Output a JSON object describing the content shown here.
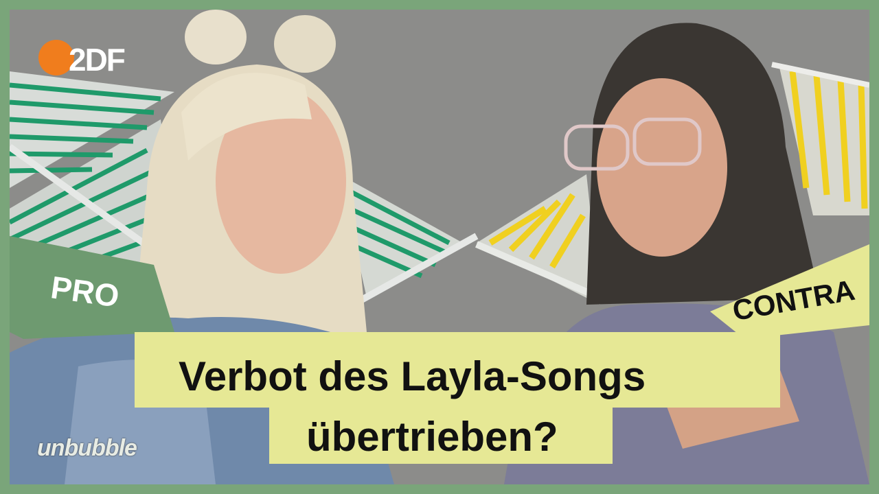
{
  "channel_logo": "2DF",
  "labels": {
    "pro": "PRO",
    "contra": "CONTRA"
  },
  "headline": {
    "line1": "Verbot des Layla-Songs",
    "line2": "übertrieben?"
  },
  "brand": "unbubble",
  "colors": {
    "frame": "#7aa57a",
    "headline_bg": "#e6e895",
    "pro_tag": "#6e9a70",
    "contra_tag": "#e6e895",
    "logo_orange": "#f07d1d",
    "green_stripes": "#1f9a6a",
    "yellow_stripes": "#f0d020"
  }
}
